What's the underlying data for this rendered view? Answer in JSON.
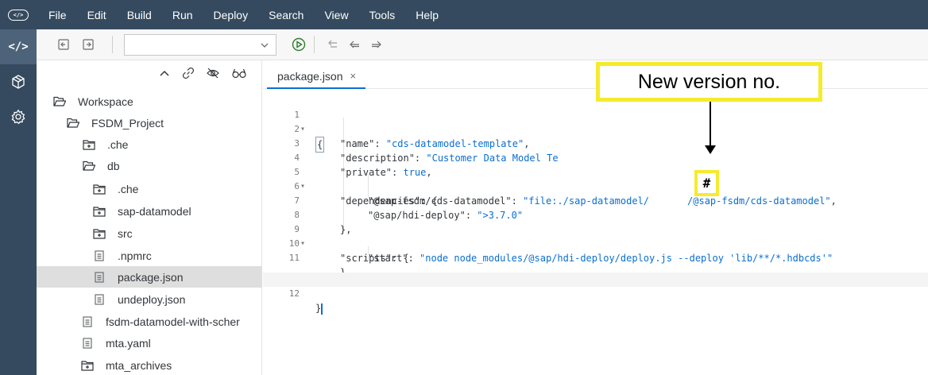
{
  "menubar": {
    "items": [
      "File",
      "Edit",
      "Build",
      "Run",
      "Deploy",
      "Search",
      "View",
      "Tools",
      "Help"
    ]
  },
  "activity_bar": {
    "items": [
      "code-icon",
      "package-icon",
      "gear-icon"
    ],
    "active": "code-icon"
  },
  "toolbar": {
    "run_config_value": "",
    "icons": [
      "collapse-icon",
      "expand-icon",
      "run-icon",
      "previous-edit-icon",
      "back-icon",
      "forward-icon"
    ]
  },
  "explorer": {
    "actions": [
      "collapse-all-icon",
      "link-icon",
      "hide-icon",
      "preview-icon"
    ],
    "tree": [
      {
        "label": "Workspace",
        "type": "folder-open",
        "level": 0
      },
      {
        "label": "FSDM_Project",
        "type": "folder-open",
        "level": 1
      },
      {
        "label": ".che",
        "type": "folder-closed",
        "level": 2
      },
      {
        "label": "db",
        "type": "folder-open",
        "level": 2
      },
      {
        "label": ".che",
        "type": "folder-closed",
        "level": 3
      },
      {
        "label": "sap-datamodel",
        "type": "folder-closed",
        "level": 3
      },
      {
        "label": "src",
        "type": "folder-closed",
        "level": 3
      },
      {
        "label": ".npmrc",
        "type": "file",
        "level": 3
      },
      {
        "label": "package.json",
        "type": "file",
        "level": 3,
        "selected": true
      },
      {
        "label": "undeploy.json",
        "type": "file",
        "level": 3
      },
      {
        "label": "fsdm-datamodel-with-scher",
        "type": "file",
        "level": 2
      },
      {
        "label": "mta.yaml",
        "type": "file",
        "level": 2
      },
      {
        "label": "mta_archives",
        "type": "folder-closed",
        "level": 1
      }
    ]
  },
  "editor": {
    "tab_label": "package.json",
    "tab_close": "×",
    "line_numbers": [
      "1",
      "2",
      "3",
      "4",
      "5",
      "6",
      "7",
      "8",
      "9",
      "10",
      "11",
      "12"
    ],
    "lines": {
      "l1_text": "{",
      "l2_key": "\"name\"",
      "l2_val": "\"cds-datamodel-template\"",
      "l3_key": "\"description\"",
      "l3_val": "\"Customer Data Model Te",
      "l4_key": "\"private\"",
      "l4_val": "true",
      "l5_key": "\"dependencies\"",
      "l6_key": "\"@sap-fsdm/cds-datamodel\"",
      "l6_val_prefix": "\"file:./sap-datamodel/",
      "l6_val_suffix": "/@sap-fsdm/cds-datamodel\"",
      "l7_key": "\"@sap/hdi-deploy\"",
      "l7_val": "\">3.7.0\"",
      "l8_text": "},",
      "l9_key": "\"scripts\"",
      "l10_key": "\"start\"",
      "l10_val": "\"node node_modules/@sap/hdi-deploy/deploy.js --deploy 'lib/**/*.hdbcds'\"",
      "l11_text": "}",
      "l12_text": "}"
    }
  },
  "annotation": {
    "callout_text": "New version no.",
    "placeholder_text": "#",
    "highlight_color": "#f5eb2e"
  },
  "colors": {
    "menubar_bg": "#354a5f",
    "string_color": "#0a6ed1",
    "selection_bg": "#dedede"
  }
}
